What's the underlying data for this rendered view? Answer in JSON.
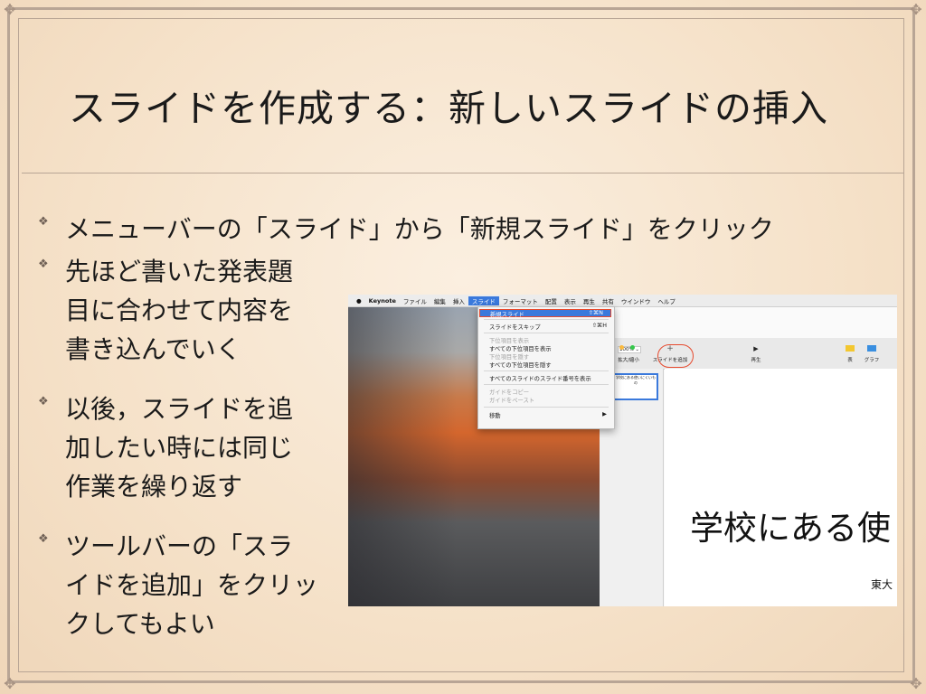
{
  "title": "スライドを作成する：新しいスライドの挿入",
  "bullets": [
    {
      "text": "メニューバーの「スライド」から「新規スライド」をクリック"
    },
    {
      "text": "先ほど書いた発表題\n目に合わせて内容を\n書き込んでいく"
    },
    {
      "text": "以後，スライドを追\n加したい時には同じ\n作業を繰り返す"
    },
    {
      "text": "ツールバーの「スラ\nイドを追加」をクリッ\nクしてもよい"
    }
  ],
  "bullet_icon": "diamond-bullet-icon",
  "screenshot": {
    "menubar": [
      "Keynote",
      "ファイル",
      "編集",
      "挿入",
      "スライド",
      "フォーマット",
      "配置",
      "表示",
      "再生",
      "共有",
      "ウインドウ",
      "ヘルプ"
    ],
    "menu": {
      "new_slide": "新規スライド",
      "new_slide_sc": "⇧⌘N",
      "skip_slide": "スライドをスキップ",
      "skip_slide_sc": "⇧⌘H",
      "show_sub": "下位項目を表示",
      "show_all_sub": "すべての下位項目を表示",
      "hide_sub": "下位項目を隠す",
      "hide_all_sub": "すべての下位項目を隠す",
      "show_numbers": "すべてのスライドのスライド番号を表示",
      "copy_guide": "ガイドをコピー",
      "paste_guide": "ガイドをペースト",
      "move": "移動",
      "arrow": "▶"
    },
    "toolbar": {
      "zoom": "100% ⌄",
      "zoom_label": "拡大/縮小",
      "add_slide_plus": "+",
      "add_slide_label": "スライドを追加",
      "play_label": "再生",
      "table_label": "表",
      "chart_label": "グラフ",
      "left_fragment": "示",
      "play_icon": "▶"
    },
    "thumb_text": "学校にある使いにくいもの",
    "slide_title": "学校にある使",
    "slide_subtitle": "東大"
  },
  "colors": {
    "accent": "#3a79dc",
    "highlight": "#e64a2e",
    "frame": "#b8a595"
  }
}
